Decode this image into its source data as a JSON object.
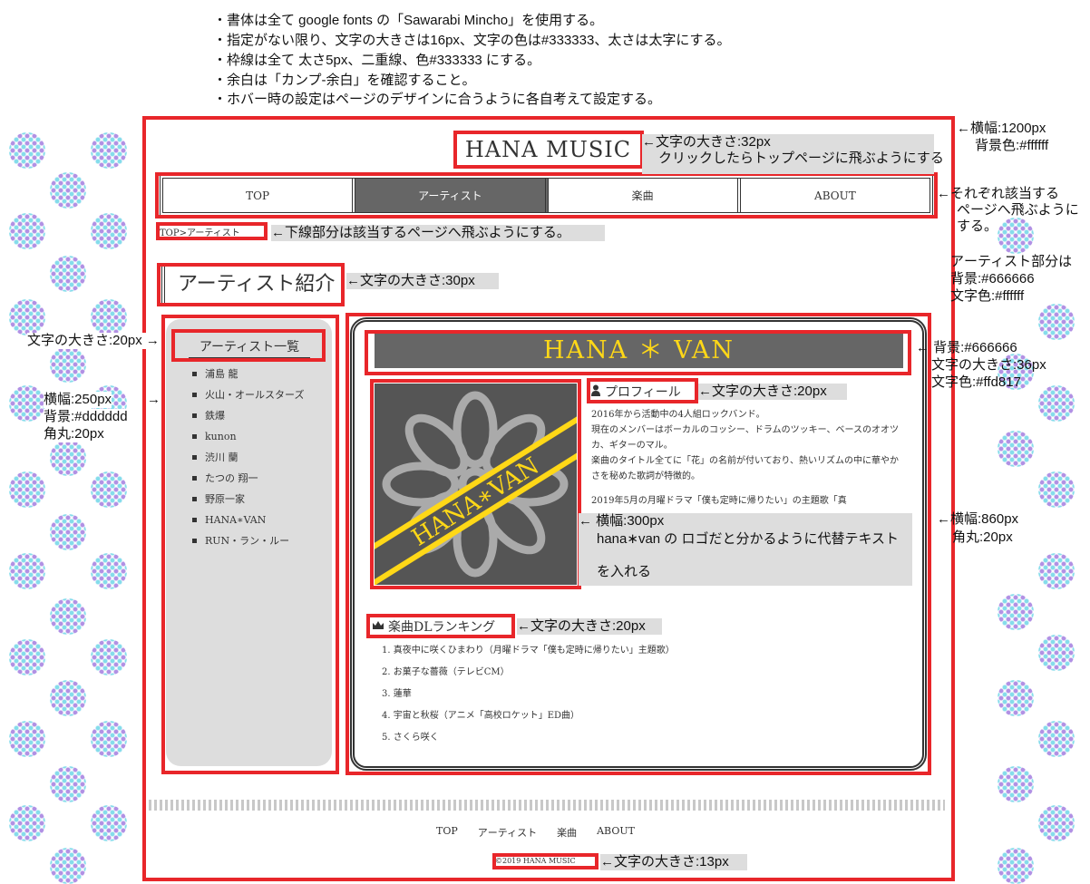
{
  "notes": [
    "・書体は全て google fonts の「Sawarabi Mincho」を使用する。",
    "・指定がない限り、文字の大きさは16px、文字の色は#333333、太さは太字にする。",
    "・枠線は全て 太さ5px、二重線、色#333333 にする。",
    "・余白は「カンプ-余白」を確認すること。",
    "・ホバー時の設定はページのデザインに合うように各自考えて設定する。"
  ],
  "site_title": "HANA MUSIC",
  "nav": [
    "TOP",
    "アーティスト",
    "楽曲",
    "ABOUT"
  ],
  "breadcrumb": {
    "home": "TOP",
    "sep": ">",
    "current": "アーティスト"
  },
  "page_title": "アーティスト紹介",
  "sidebar": {
    "heading": "アーティスト一覧",
    "items": [
      "浦島 龍",
      "火山・オールスターズ",
      "鉄爆",
      "kunon",
      "渋川 蘭",
      "たつの 翔一",
      "野原一家",
      "HANA∗VAN",
      "RUN・ラン・ルー"
    ]
  },
  "artist": {
    "name": "HANA ＊ VAN",
    "logo_text": "HANA∗VAN",
    "profile_heading": "プロフィール",
    "profile": [
      "2016年から活動中の4人組ロックバンド。",
      "現在のメンバーはボーカルのコッシー、ドラムのツッキー、ベースのオオツカ、ギターのマル。",
      "楽曲のタイトル全てに「花」の名前が付いており、熱いリズムの中に華やかさを秘めた歌詞が特徴的。",
      "",
      "2019年5月の月曜ドラマ「僕も定時に帰りたい」の主題歌「真"
    ],
    "ranking_heading": "楽曲DLランキング",
    "ranking": [
      "1. 真夜中に咲くひまわり（月曜ドラマ「僕も定時に帰りたい」主題歌）",
      "2. お菓子な薔薇（テレビCM）",
      "3. 蓮華",
      "4. 宇宙と秋桜（アニメ「高校ロケット」ED曲）",
      "5. さくら咲く"
    ]
  },
  "footer_nav": [
    "TOP",
    "アーティスト",
    "楽曲",
    "ABOUT"
  ],
  "copyright": "©2019 HANA MUSIC",
  "annotations": {
    "title_size": "←文字の大きさ:32px",
    "title_link": "クリックしたらトップページに飛ぶようにする",
    "nav_link": "←それぞれ該当する",
    "nav_link2": "ページへ飛ぶようにする。",
    "crumb_link": "←下線部分は該当するページへ飛ぶようにする。",
    "page_title_size": "←文字の大きさ:30px",
    "width1200": "←横幅:1200px",
    "bg_white": "背景色:#ffffff",
    "artist_part": "アーティスト部分は",
    "artist_bg": "背景:#666666",
    "artist_color": "文字色:#ffffff",
    "side_font": "文字の大きさ:20px →",
    "side_width": "横幅:250px",
    "side_bg": "背景:#dddddd",
    "side_radius": "角丸:20px",
    "side_arrow": "→",
    "bar_bg": "← 背景:#666666",
    "bar_size": "文字の大きさ:36px",
    "bar_color": "文字色:#ffd817",
    "profile_size": "←文字の大きさ:20px",
    "logo_width": "← 横幅:300px",
    "logo_alt1": "hana∗van の ロゴだと分かるように代替テキスト",
    "logo_alt2": "を入れる",
    "main_width": "←横幅:860px",
    "main_radius": "角丸:20px",
    "rank_size": "←文字の大きさ:20px",
    "copy_size": "←文字の大きさ:13px"
  }
}
